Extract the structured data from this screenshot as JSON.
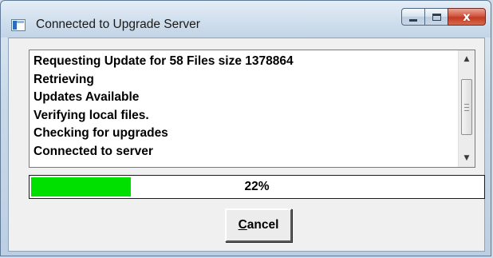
{
  "window": {
    "title": "Connected to Upgrade Server",
    "app_icon": "app-window-icon",
    "caption_buttons": {
      "minimize_icon": "minimize-icon",
      "maximize_icon": "maximize-icon",
      "close_icon": "close-icon",
      "close_glyph": "x"
    }
  },
  "log": {
    "lines": [
      "Requesting Update for 58 Files size 1378864",
      "Retrieving",
      "Updates Available",
      "Verifying local files.",
      "Checking for upgrades",
      "Connected to server"
    ],
    "scrollbar": {
      "up_arrow": "▲",
      "down_arrow": "▼"
    }
  },
  "progress": {
    "value": 0.22,
    "label": "22%",
    "fill_color": "#00e000"
  },
  "buttons": {
    "cancel_mnemonic": "C",
    "cancel_rest": "ancel"
  }
}
